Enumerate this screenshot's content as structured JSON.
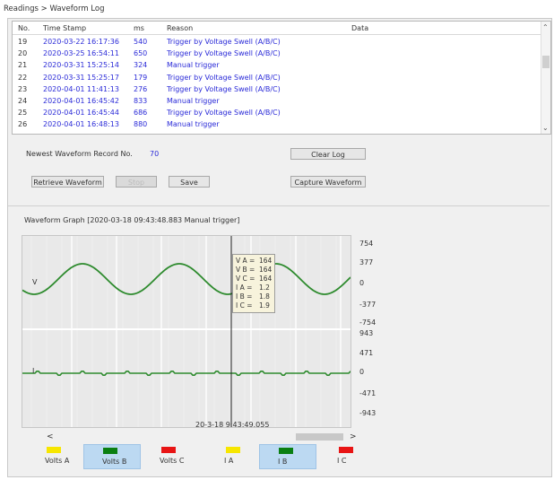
{
  "breadcrumb": "Readings > Waveform Log",
  "log": {
    "headers": {
      "no": "No.",
      "time": "Time Stamp",
      "ms": "ms",
      "reason": "Reason",
      "data": "Data"
    },
    "rows": [
      {
        "no": "19",
        "time": "2020-03-22 16:17:36",
        "ms": "540",
        "reason": "Trigger by Voltage Swell (A/B/C)"
      },
      {
        "no": "20",
        "time": "2020-03-25 16:54:11",
        "ms": "650",
        "reason": "Trigger by Voltage Swell (A/B/C)"
      },
      {
        "no": "21",
        "time": "2020-03-31 15:25:14",
        "ms": "324",
        "reason": "Manual trigger"
      },
      {
        "no": "22",
        "time": "2020-03-31 15:25:17",
        "ms": "179",
        "reason": "Trigger by Voltage Swell (A/B/C)"
      },
      {
        "no": "23",
        "time": "2020-04-01 11:41:13",
        "ms": "276",
        "reason": "Trigger by Voltage Swell (A/B/C)"
      },
      {
        "no": "24",
        "time": "2020-04-01 16:45:42",
        "ms": "833",
        "reason": "Manual trigger"
      },
      {
        "no": "25",
        "time": "2020-04-01 16:45:44",
        "ms": "686",
        "reason": "Trigger by Voltage Swell (A/B/C)"
      },
      {
        "no": "26",
        "time": "2020-04-01 16:48:13",
        "ms": "880",
        "reason": "Manual trigger"
      }
    ]
  },
  "controls": {
    "newest_label": "Newest Waveform Record No.",
    "newest_value": "70",
    "clear_log": "Clear Log",
    "retrieve": "Retrieve Waveform",
    "stop": "Stop",
    "save": "Save",
    "capture": "Capture Waveform"
  },
  "graph": {
    "title": "Waveform Graph  [2020-03-18 09:43:48.883 Manual trigger]",
    "v_label": "V",
    "i_label": "I",
    "v_ticks": [
      "754",
      "377",
      "0",
      "-377",
      "-754"
    ],
    "i_ticks": [
      "943",
      "471",
      "0",
      "-471",
      "-943"
    ],
    "time_label": "20-3-18 9:43:49.055",
    "scroll_left": "<",
    "scroll_right": ">",
    "tooltip": [
      {
        "k": "V A =",
        "v": "164"
      },
      {
        "k": "V B =",
        "v": "164"
      },
      {
        "k": "V C =",
        "v": "164"
      },
      {
        "k": "I A =",
        "v": "1.2"
      },
      {
        "k": "I B =",
        "v": "1.8"
      },
      {
        "k": "I C =",
        "v": "1.9"
      }
    ],
    "colors": {
      "trace": "#2e8b2e",
      "grid": "#ffffff",
      "plot_bg": "#e9e9e9",
      "yellow": "#f7e600",
      "green": "#0a7f12",
      "red": "#e81414",
      "selected_bg": "#bcd9f2"
    }
  },
  "legend": [
    {
      "label": "Volts  A",
      "color": "#f7e600",
      "selected": false
    },
    {
      "label": "Volts  B",
      "color": "#0a7f12",
      "selected": true
    },
    {
      "label": "Volts  C",
      "color": "#e81414",
      "selected": false
    },
    {
      "label": "I  A",
      "color": "#f7e600",
      "selected": false
    },
    {
      "label": "I  B",
      "color": "#0a7f12",
      "selected": true
    },
    {
      "label": "I  C",
      "color": "#e81414",
      "selected": false
    }
  ]
}
